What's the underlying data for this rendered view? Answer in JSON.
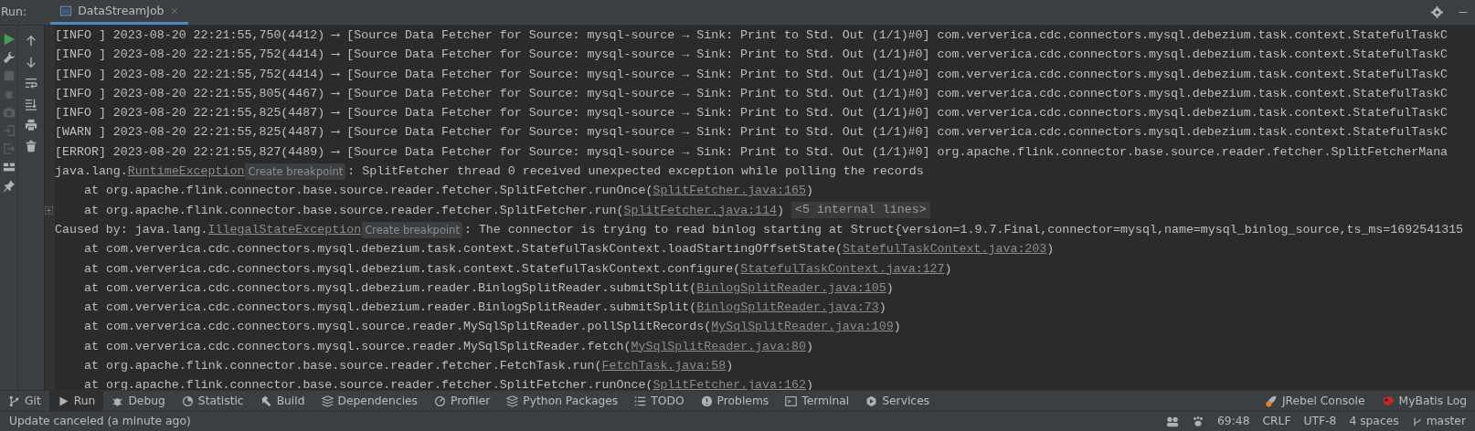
{
  "run_label": "Run:",
  "tabs": [
    {
      "label": "DataStreamJob",
      "selected": true
    }
  ],
  "console": {
    "lines": [
      {
        "kind": "log",
        "parts": [
          {
            "kind": "text",
            "text": "[INFO ] 2023-08-20 22:21:55,750(4412) ⟶ [Source Data Fetcher for Source: mysql-source → Sink: Print to Std. Out (1/1)#0] com.ververica.cdc.connectors.mysql.debezium.task.context.StatefulTaskC"
          }
        ]
      },
      {
        "kind": "log",
        "parts": [
          {
            "kind": "text",
            "text": "[INFO ] 2023-08-20 22:21:55,752(4414) ⟶ [Source Data Fetcher for Source: mysql-source → Sink: Print to Std. Out (1/1)#0] com.ververica.cdc.connectors.mysql.debezium.task.context.StatefulTaskC"
          }
        ]
      },
      {
        "kind": "log",
        "parts": [
          {
            "kind": "text",
            "text": "[INFO ] 2023-08-20 22:21:55,752(4414) ⟶ [Source Data Fetcher for Source: mysql-source → Sink: Print to Std. Out (1/1)#0] com.ververica.cdc.connectors.mysql.debezium.task.context.StatefulTaskC"
          }
        ]
      },
      {
        "kind": "log",
        "parts": [
          {
            "kind": "text",
            "text": "[INFO ] 2023-08-20 22:21:55,805(4467) ⟶ [Source Data Fetcher for Source: mysql-source → Sink: Print to Std. Out (1/1)#0] com.ververica.cdc.connectors.mysql.debezium.task.context.StatefulTaskC"
          }
        ]
      },
      {
        "kind": "log",
        "parts": [
          {
            "kind": "text",
            "text": "[INFO ] 2023-08-20 22:21:55,825(4487) ⟶ [Source Data Fetcher for Source: mysql-source → Sink: Print to Std. Out (1/1)#0] com.ververica.cdc.connectors.mysql.debezium.task.context.StatefulTaskC"
          }
        ]
      },
      {
        "kind": "log",
        "parts": [
          {
            "kind": "text",
            "text": "[WARN ] 2023-08-20 22:21:55,825(4487) ⟶ [Source Data Fetcher for Source: mysql-source → Sink: Print to Std. Out (1/1)#0] com.ververica.cdc.connectors.mysql.debezium.task.context.StatefulTaskC"
          }
        ]
      },
      {
        "kind": "log",
        "parts": [
          {
            "kind": "text",
            "text": "[ERROR] 2023-08-20 22:21:55,827(4489) ⟶ [Source Data Fetcher for Source: mysql-source → Sink: Print to Std. Out (1/1)#0] org.apache.flink.connector.base.source.reader.fetcher.SplitFetcherMana"
          }
        ]
      },
      {
        "kind": "head",
        "parts": [
          {
            "kind": "text",
            "text": "java.lang."
          },
          {
            "kind": "link",
            "text": "RuntimeException"
          },
          {
            "kind": "chip",
            "text": "Create breakpoint"
          },
          {
            "kind": "text",
            "text": ": SplitFetcher thread 0 received unexpected exception while polling the records"
          }
        ]
      },
      {
        "kind": "frame",
        "parts": [
          {
            "kind": "text",
            "text": "at org.apache.flink.connector.base.source.reader.fetcher.SplitFetcher.runOnce("
          },
          {
            "kind": "link",
            "text": "SplitFetcher.java:165"
          },
          {
            "kind": "text",
            "text": ")"
          }
        ]
      },
      {
        "kind": "frame-fold",
        "parts": [
          {
            "kind": "text",
            "text": "at org.apache.flink.connector.base.source.reader.fetcher.SplitFetcher.run("
          },
          {
            "kind": "link",
            "text": "SplitFetcher.java:114"
          },
          {
            "kind": "text",
            "text": ")"
          },
          {
            "kind": "fold",
            "text": "<5 internal lines>"
          }
        ]
      },
      {
        "kind": "head",
        "parts": [
          {
            "kind": "text",
            "text": "Caused by: java.lang."
          },
          {
            "kind": "link",
            "text": "IllegalStateException"
          },
          {
            "kind": "chip",
            "text": "Create breakpoint"
          },
          {
            "kind": "text",
            "text": ": The connector is trying to read binlog starting at Struct{version=1.9.7.Final,connector=mysql,name=mysql_binlog_source,ts_ms=1692541315"
          }
        ]
      },
      {
        "kind": "frame",
        "parts": [
          {
            "kind": "text",
            "text": "at com.ververica.cdc.connectors.mysql.debezium.task.context.StatefulTaskContext.loadStartingOffsetState("
          },
          {
            "kind": "link",
            "text": "StatefulTaskContext.java:203"
          },
          {
            "kind": "text",
            "text": ")"
          }
        ]
      },
      {
        "kind": "frame",
        "parts": [
          {
            "kind": "text",
            "text": "at com.ververica.cdc.connectors.mysql.debezium.task.context.StatefulTaskContext.configure("
          },
          {
            "kind": "link",
            "text": "StatefulTaskContext.java:127"
          },
          {
            "kind": "text",
            "text": ")"
          }
        ]
      },
      {
        "kind": "frame",
        "parts": [
          {
            "kind": "text",
            "text": "at com.ververica.cdc.connectors.mysql.debezium.reader.BinlogSplitReader.submitSplit("
          },
          {
            "kind": "link",
            "text": "BinlogSplitReader.java:105"
          },
          {
            "kind": "text",
            "text": ")"
          }
        ]
      },
      {
        "kind": "frame",
        "parts": [
          {
            "kind": "text",
            "text": "at com.ververica.cdc.connectors.mysql.debezium.reader.BinlogSplitReader.submitSplit("
          },
          {
            "kind": "link",
            "text": "BinlogSplitReader.java:73"
          },
          {
            "kind": "text",
            "text": ")"
          }
        ]
      },
      {
        "kind": "frame",
        "parts": [
          {
            "kind": "text",
            "text": "at com.ververica.cdc.connectors.mysql.source.reader.MySqlSplitReader.pollSplitRecords("
          },
          {
            "kind": "link",
            "text": "MySqlSplitReader.java:109"
          },
          {
            "kind": "text",
            "text": ")"
          }
        ]
      },
      {
        "kind": "frame",
        "parts": [
          {
            "kind": "text",
            "text": "at com.ververica.cdc.connectors.mysql.source.reader.MySqlSplitReader.fetch("
          },
          {
            "kind": "link",
            "text": "MySqlSplitReader.java:80"
          },
          {
            "kind": "text",
            "text": ")"
          }
        ]
      },
      {
        "kind": "frame",
        "parts": [
          {
            "kind": "text",
            "text": "at org.apache.flink.connector.base.source.reader.fetcher.FetchTask.run("
          },
          {
            "kind": "link",
            "text": "FetchTask.java:58"
          },
          {
            "kind": "text",
            "text": ")"
          }
        ]
      },
      {
        "kind": "frame",
        "parts": [
          {
            "kind": "text",
            "text": "at org.apache.flink.connector.base.source.reader.fetcher.SplitFetcher.runOnce("
          },
          {
            "kind": "link",
            "text": "SplitFetcher.java:162"
          },
          {
            "kind": "text",
            "text": ")"
          }
        ]
      }
    ]
  },
  "toolbar": {
    "items": [
      {
        "label": "Git",
        "selected": false
      },
      {
        "label": "Run",
        "selected": true
      },
      {
        "label": "Debug",
        "selected": false
      },
      {
        "label": "Statistic",
        "selected": false
      },
      {
        "label": "Build",
        "selected": false
      },
      {
        "label": "Dependencies",
        "selected": false
      },
      {
        "label": "Profiler",
        "selected": false
      },
      {
        "label": "Python Packages",
        "selected": false
      },
      {
        "label": "TODO",
        "selected": false
      },
      {
        "label": "Problems",
        "selected": false
      },
      {
        "label": "Terminal",
        "selected": false
      },
      {
        "label": "Services",
        "selected": false
      }
    ],
    "right_items": [
      {
        "label": "JRebel Console",
        "selected": false
      },
      {
        "label": "MyBatis Log",
        "selected": false
      }
    ]
  },
  "status_bar": {
    "message": "Update canceled (a minute ago)",
    "items": [
      "69:48",
      "CRLF",
      "UTF-8",
      "4 spaces",
      "master"
    ]
  }
}
